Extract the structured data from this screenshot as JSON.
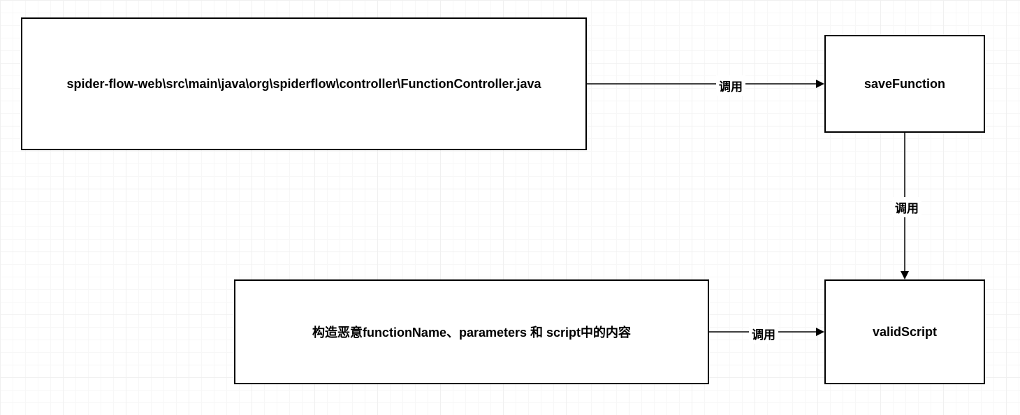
{
  "nodes": {
    "functionController": {
      "label": "spider-flow-web\\src\\main\\java\\org\\spiderflow\\controller\\FunctionController.java"
    },
    "saveFunction": {
      "label": "saveFunction"
    },
    "maliciousPayload": {
      "label": "构造恶意functionName、parameters 和 script中的内容"
    },
    "validScript": {
      "label": "validScript"
    }
  },
  "edges": {
    "edge1": {
      "label": "调用"
    },
    "edge2": {
      "label": "调用"
    },
    "edge3": {
      "label": "调用"
    }
  }
}
